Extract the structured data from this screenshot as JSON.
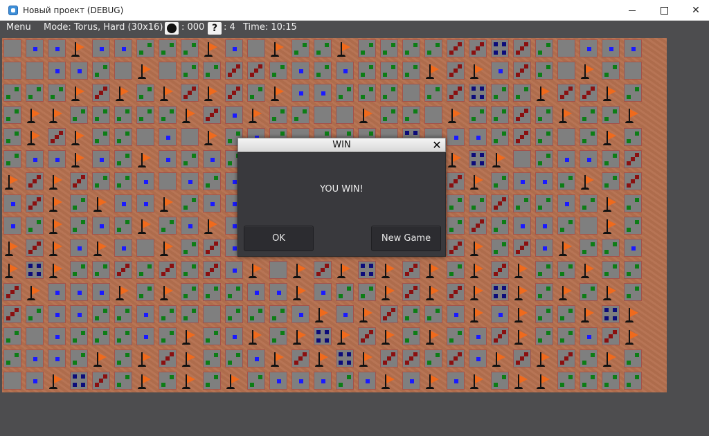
{
  "window": {
    "title": "Новый проект (DEBUG)",
    "minimize_glyph": "—",
    "close_glyph": "✕"
  },
  "status": {
    "menu_label": "Menu",
    "mode_text": "Mode:  Torus, Hard (30x16)",
    "mine_count_text": ": 000",
    "question_count_text": ": 4",
    "time_text": "Time:   10:15",
    "mine_icon": "mine-icon",
    "question_icon": "question-icon",
    "question_glyph": "?"
  },
  "board": {
    "cols": 30,
    "rows": 16,
    "legend": {
      "F": "flag",
      "0": "empty revealed",
      "1": "one (blue)",
      "2": "two (green)",
      "3": "three (red)",
      "4": "four (navy)"
    },
    "grid": [
      "011F11222F10F22F2222334320111",
      "001120F022332121222F3F1320F20",
      "222F3F2F3F32F11222023422F33F2",
      "2FF22222F31F2200F220F2232F22F",
      "2F3F22010F21202220401123202F2",
      "211F12F1212F21212212F4F021123",
      "F3F3221012132121110F3F2112F23",
      "13F2F11F2111222F11F32232212F2",
      "12F212F21F111111F11F2321120F2",
      "F3F1F10F23111122F1F23F231F221",
      "F4F22323231F0F3F4F3F2F3F22F22",
      "3F111F2F22211F122F3F3F4F2F2F2",
      "32112212202221F1F3221F1F22F4F",
      "20122212F21F2F4F3F2F213F2213F",
      "2112F2F3F221F3F4F33231F3F32F2",
      "01F432F2F2F211121F1F1F2FF2222"
    ]
  },
  "dialog": {
    "title": "WIN",
    "message": "YOU WIN!",
    "ok_label": "OK",
    "new_game_label": "New Game",
    "close_glyph": "✕"
  }
}
